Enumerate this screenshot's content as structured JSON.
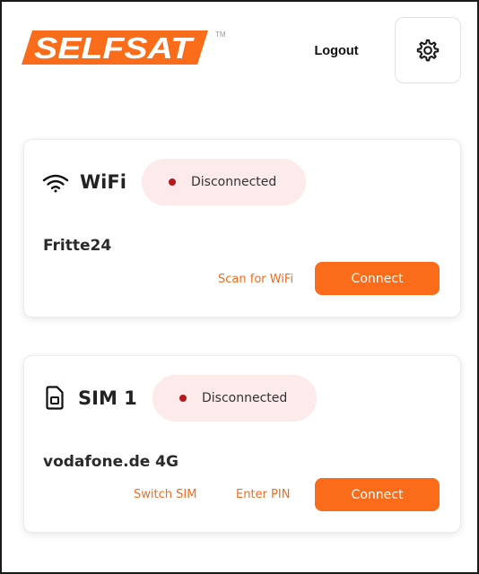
{
  "header": {
    "brand": "SELFSAT",
    "trademark": "TM",
    "logout_label": "Logout",
    "settings_icon": "gear-icon"
  },
  "colors": {
    "accent": "#fa6b1a",
    "status_bg": "#fdeaea",
    "status_dot": "#b3191e"
  },
  "wifi": {
    "title": "WiFi",
    "icon": "wifi-icon",
    "status": "Disconnected",
    "network": "Fritte24",
    "scan_label": "Scan for WiFi",
    "connect_label": "Connect"
  },
  "sim": {
    "title": "SIM 1",
    "icon": "sim-card-icon",
    "status": "Disconnected",
    "network": "vodafone.de 4G",
    "switch_label": "Switch SIM",
    "pin_label": "Enter PIN",
    "connect_label": "Connect"
  }
}
